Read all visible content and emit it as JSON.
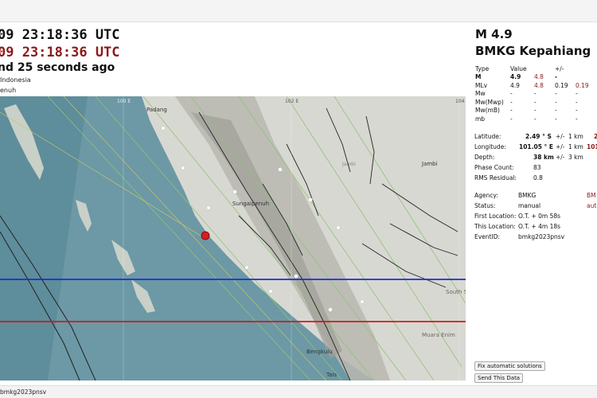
{
  "header": {
    "time_utc": "09 23:18:36 UTC",
    "time_utc_2": "09 23:18:36 UTC",
    "ago": "nd 25 seconds ago",
    "region": "Indonesia",
    "nearby": "enuh"
  },
  "map": {
    "labels": {
      "padang": "Padang",
      "sungaipenuh": "Sungaipenuh",
      "jambi": "Jambi",
      "jambi_small": "Jambi",
      "bengkulu": "Bengkulu",
      "south_su": "South Su",
      "muara_enim": "Muara Enim",
      "tais": "Tais",
      "lon_100": "100 E",
      "lon_102": "102 E",
      "lon_104": "104"
    },
    "colors": {
      "sea": "#6d9aa6",
      "land": "#d9d9d4",
      "epicenter": "#d42020",
      "line_blue": "#1a2fd0",
      "line_red": "#d01a1a"
    }
  },
  "event": {
    "magnitude": "M 4.9",
    "agency_title": "BMKG Kepahiang",
    "mag_table": {
      "headers": [
        "Type",
        "Value",
        "",
        "+/-",
        ""
      ],
      "rows": [
        {
          "type": "M",
          "value": "4.9",
          "value2": "4.8",
          "err": "-",
          "extra": ""
        },
        {
          "type": "MLv",
          "value": "4.9",
          "value2": "4.8",
          "err": "0.19",
          "extra": "0.19"
        },
        {
          "type": "Mw",
          "value": "-",
          "value2": "-",
          "err": "-",
          "extra": "-"
        },
        {
          "type": "Mw(Mwp)",
          "value": "-",
          "value2": "-",
          "err": "-",
          "extra": "-"
        },
        {
          "type": "Mw(mB)",
          "value": "-",
          "value2": "-",
          "err": "-",
          "extra": "-"
        },
        {
          "type": "mb",
          "value": "-",
          "value2": "-",
          "err": "-",
          "extra": "-"
        }
      ]
    },
    "location": {
      "latitude_label": "Latitude:",
      "latitude_value": "2.49 ° S",
      "latitude_pm": "+/-",
      "latitude_err": "1 km",
      "latitude_extra": "2",
      "longitude_label": "Longitude:",
      "longitude_value": "101.05 ° E",
      "longitude_pm": "+/-",
      "longitude_err": "1 km",
      "longitude_extra": "101",
      "depth_label": "Depth:",
      "depth_value": "38 km",
      "depth_pm": "+/-",
      "depth_err": "3 km",
      "phase_label": "Phase Count:",
      "phase_value": "83",
      "rms_label": "RMS Residual:",
      "rms_value": "0.8"
    },
    "info": {
      "agency_label": "Agency:",
      "agency_value": "BMKG",
      "agency_extra": "BM",
      "status_label": "Status:",
      "status_value": "manual",
      "status_extra": "aut",
      "first_label": "First Location:",
      "first_value": "O.T. + 0m 58s",
      "this_label": "This Location:",
      "this_value": "O.T. + 4m 18s",
      "eventid_label": "EventID:",
      "eventid_value": "bmkg2023pnsv"
    },
    "buttons": {
      "fix": "Fix automatic solutions",
      "send": "Send This Data"
    }
  },
  "statusbar": {
    "event_id": "bmkg2023pnsv"
  }
}
